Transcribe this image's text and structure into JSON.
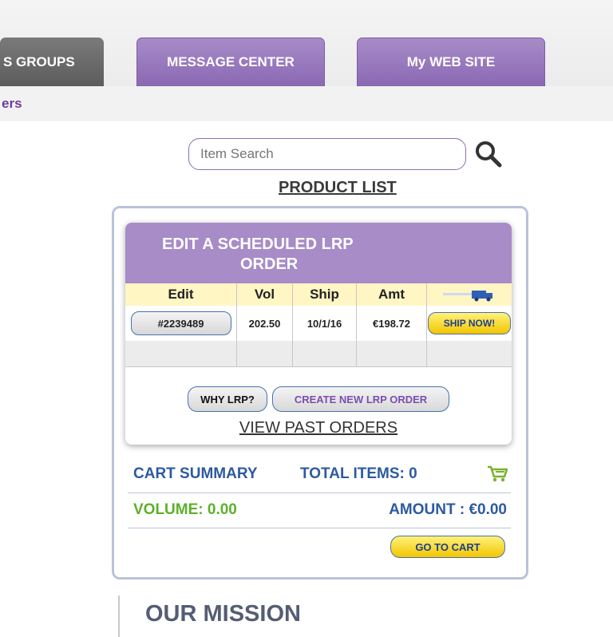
{
  "nav": {
    "tabs": [
      {
        "label": "S GROUPS",
        "color": "#6e6e6e"
      },
      {
        "label": "MESSAGE CENTER",
        "color": "#9b7bc1"
      },
      {
        "label": "My WEB SITE",
        "color": "#9b7bc1"
      }
    ],
    "subnav_text": "ers"
  },
  "search": {
    "placeholder": "Item Search",
    "icon": "search-icon"
  },
  "product_list_link": "PRODUCT LIST",
  "lrp": {
    "title_line1": "EDIT A SCHEDULED LRP",
    "title_line2": "ORDER",
    "columns": [
      "Edit",
      "Vol",
      "Ship",
      "Amt"
    ],
    "truck_icon": "truck-icon",
    "orders": [
      {
        "order": "#2239489",
        "vol": "202.50",
        "ship": "10/1/16",
        "amt": "€198.72",
        "action": "SHIP NOW!"
      }
    ],
    "why_label": "WHY LRP?",
    "create_label": "CREATE NEW LRP ORDER",
    "view_past_label": "VIEW PAST ORDERS"
  },
  "cart": {
    "summary_label": "CART SUMMARY",
    "total_items": "TOTAL ITEMS: 0",
    "cart_icon": "cart-icon",
    "volume": "VOLUME: 0.00",
    "amount": "AMOUNT : €0.00",
    "go_to_cart": "GO TO CART"
  },
  "mission_heading": "OUR MISSION",
  "colors": {
    "purple": "#a78cc8",
    "blue_text": "#2d5aa0",
    "green_text": "#5db02a",
    "yellow_button": "#f2c500",
    "header_row": "#fff6c4"
  }
}
